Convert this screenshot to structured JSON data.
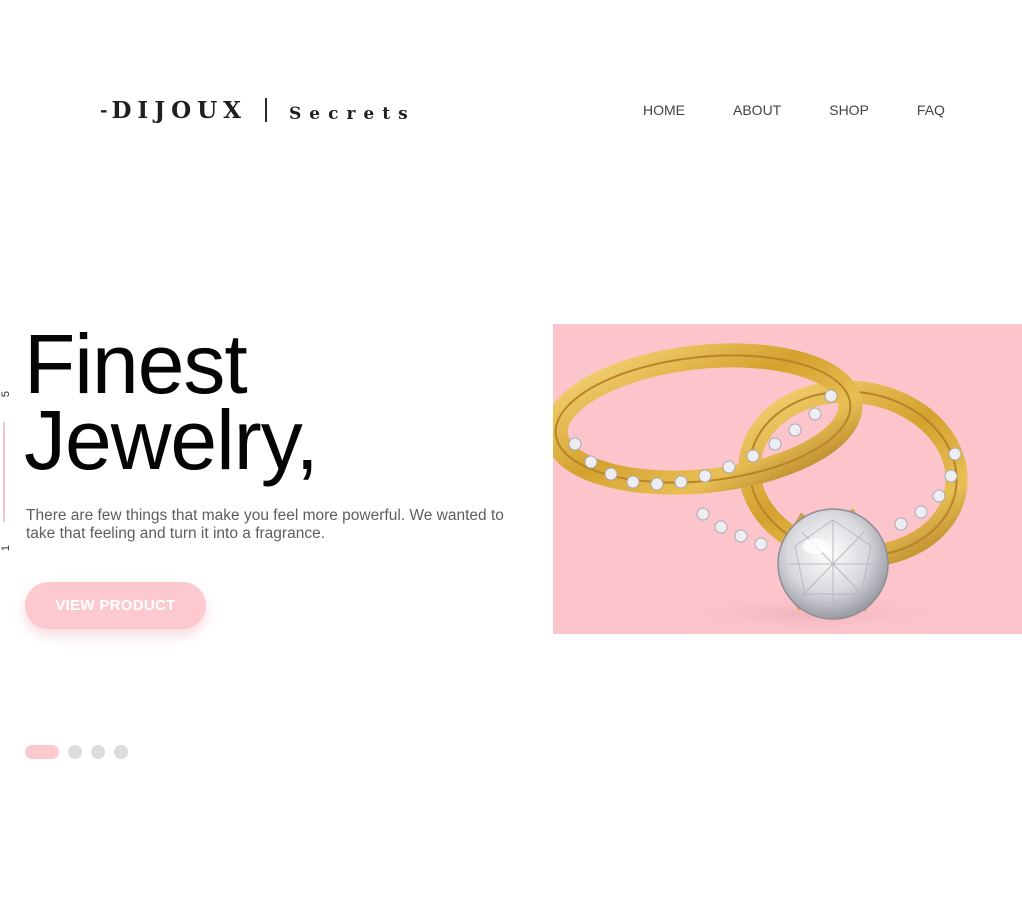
{
  "logo": {
    "dash": "-",
    "brand": "DIJOUX",
    "sub": "Secrets"
  },
  "nav": {
    "home": "HOME",
    "about": "ABOUT",
    "shop": "SHOP",
    "faq": "FAQ"
  },
  "counter": {
    "top": "5",
    "bottom": "1"
  },
  "hero": {
    "title_line1": "Finest",
    "title_line2": "Jewelry,",
    "description": "There are few things that make you feel more powerful. We wanted to take that feeling and turn it into a fragrance.",
    "cta_label": "VIEW PRODUCT"
  },
  "slider": {
    "total": 4,
    "active_index": 0
  },
  "image": {
    "subject": "gold-diamond-rings",
    "background_color": "#fcc5cc"
  },
  "colors": {
    "accent": "#fcc9cf",
    "text_dark": "#050505",
    "text_muted": "#5e5e5e",
    "dot_inactive": "#dcdcdc"
  }
}
